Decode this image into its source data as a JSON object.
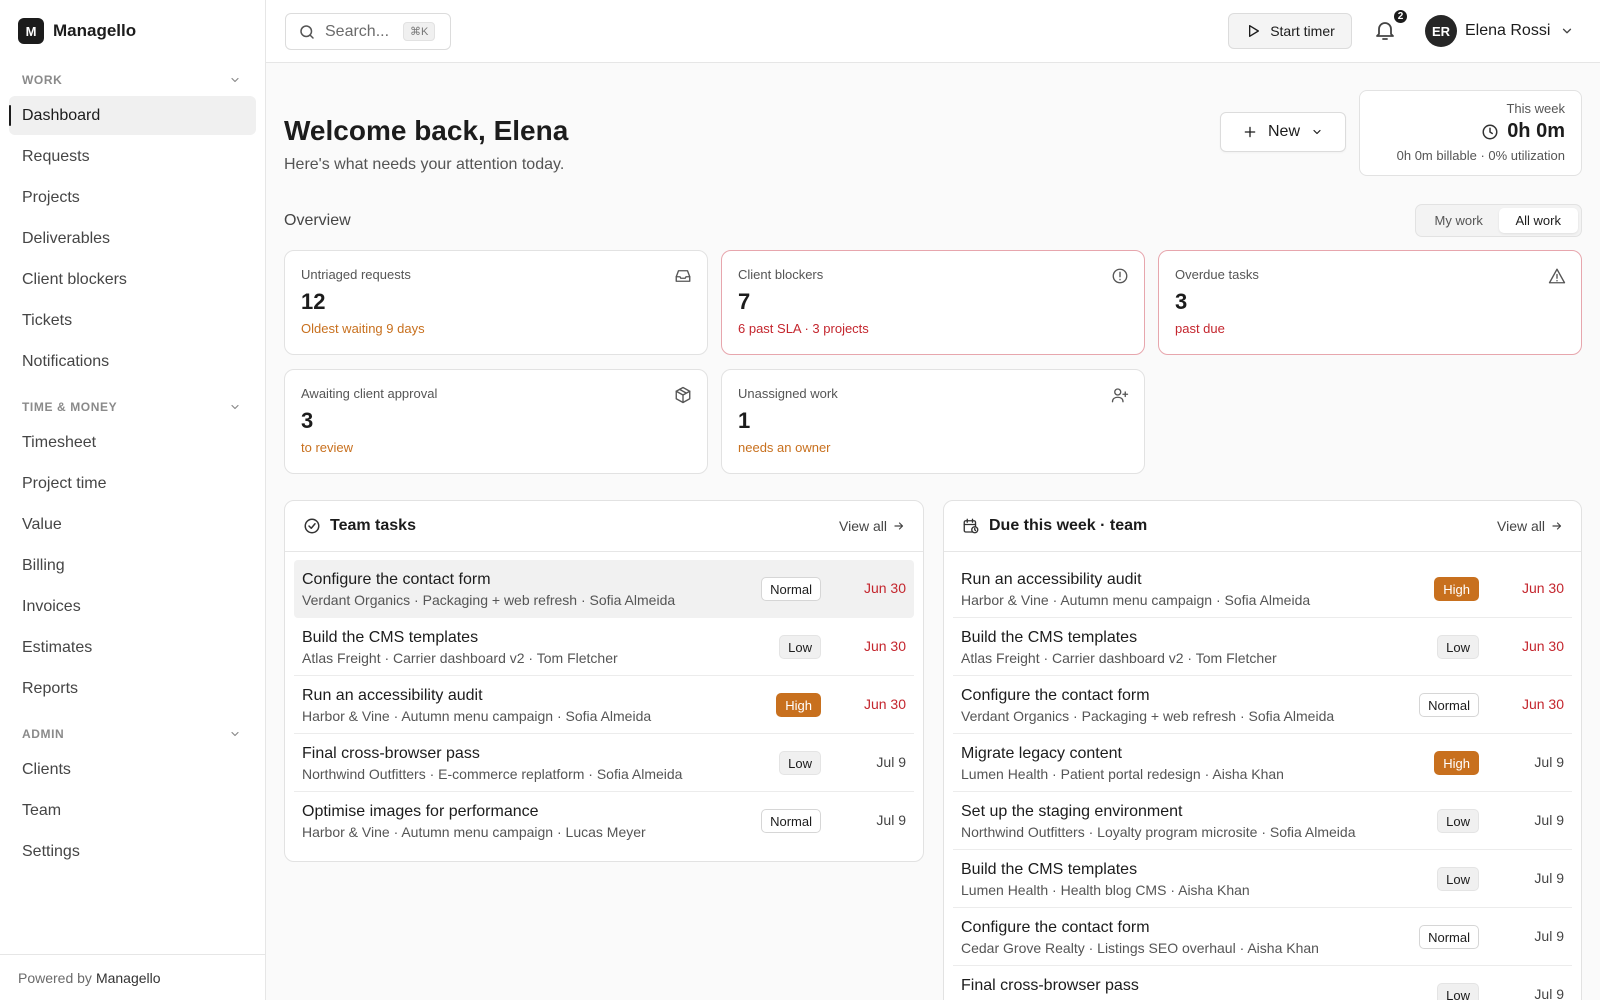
{
  "brand": {
    "logo_letter": "M",
    "name": "Managello"
  },
  "sidebar": {
    "sections": [
      {
        "title": "WORK",
        "items": [
          {
            "label": "Dashboard",
            "active": true
          },
          {
            "label": "Requests"
          },
          {
            "label": "Projects"
          },
          {
            "label": "Deliverables"
          },
          {
            "label": "Client blockers"
          },
          {
            "label": "Tickets"
          },
          {
            "label": "Notifications"
          }
        ]
      },
      {
        "title": "TIME & MONEY",
        "items": [
          {
            "label": "Timesheet"
          },
          {
            "label": "Project time"
          },
          {
            "label": "Value"
          },
          {
            "label": "Billing"
          },
          {
            "label": "Invoices"
          },
          {
            "label": "Estimates"
          },
          {
            "label": "Reports"
          }
        ]
      },
      {
        "title": "ADMIN",
        "items": [
          {
            "label": "Clients"
          },
          {
            "label": "Team"
          },
          {
            "label": "Settings"
          }
        ]
      }
    ],
    "footer": {
      "prefix": "Powered by",
      "brand": "Managello"
    }
  },
  "topbar": {
    "search_placeholder": "Search...",
    "search_shortcut": "⌘K",
    "timer_label": "Start timer",
    "notification_count": "2",
    "user": {
      "initials": "ER",
      "name": "Elena Rossi"
    }
  },
  "header": {
    "title": "Welcome back, Elena",
    "subtitle": "Here's what needs your attention today.",
    "new_label": "New"
  },
  "week": {
    "label": "This week",
    "total": "0h 0m",
    "footnote": "0h 0m billable · 0% utilization"
  },
  "overview": {
    "label": "Overview",
    "toggle": [
      "My work",
      "All work"
    ],
    "toggle_selected": "All work",
    "cards": [
      {
        "label": "Untriaged requests",
        "value": "12",
        "note": "Oldest waiting 9 days",
        "tone": "orange",
        "icon": "inbox-icon"
      },
      {
        "label": "Client blockers",
        "value": "7",
        "note": "6 past SLA · 3 projects",
        "tone": "red",
        "icon": "alert-circle-icon",
        "alert": true
      },
      {
        "label": "Overdue tasks",
        "value": "3",
        "note": "past due",
        "tone": "red",
        "icon": "warning-triangle-icon",
        "alert": true
      },
      {
        "label": "Awaiting client approval",
        "value": "3",
        "note": "to review",
        "tone": "orange",
        "icon": "package-icon"
      },
      {
        "label": "Unassigned work",
        "value": "1",
        "note": "needs an owner",
        "tone": "orange",
        "icon": "user-plus-icon"
      }
    ]
  },
  "team_tasks": {
    "title": "Team tasks",
    "view_all": "View all",
    "rows": [
      {
        "title": "Configure the contact form",
        "meta": "Verdant Organics · Packaging + web refresh · Sofia Almeida",
        "priority": "Normal",
        "date": "Jun 30",
        "overdue": true
      },
      {
        "title": "Build the CMS templates",
        "meta": "Atlas Freight · Carrier dashboard v2 · Tom Fletcher",
        "priority": "Low",
        "date": "Jun 30",
        "overdue": true
      },
      {
        "title": "Run an accessibility audit",
        "meta": "Harbor & Vine · Autumn menu campaign · Sofia Almeida",
        "priority": "High",
        "date": "Jun 30",
        "overdue": true
      },
      {
        "title": "Final cross-browser pass",
        "meta": "Northwind Outfitters · E-commerce replatform · Sofia Almeida",
        "priority": "Low",
        "date": "Jul 9",
        "overdue": false
      },
      {
        "title": "Optimise images for performance",
        "meta": "Harbor & Vine · Autumn menu campaign · Lucas Meyer",
        "priority": "Normal",
        "date": "Jul 9",
        "overdue": false
      }
    ]
  },
  "due_week": {
    "title": "Due this week · team",
    "view_all": "View all",
    "rows": [
      {
        "title": "Run an accessibility audit",
        "meta": "Harbor & Vine · Autumn menu campaign · Sofia Almeida",
        "priority": "High",
        "date": "Jun 30",
        "overdue": true
      },
      {
        "title": "Build the CMS templates",
        "meta": "Atlas Freight · Carrier dashboard v2 · Tom Fletcher",
        "priority": "Low",
        "date": "Jun 30",
        "overdue": true
      },
      {
        "title": "Configure the contact form",
        "meta": "Verdant Organics · Packaging + web refresh · Sofia Almeida",
        "priority": "Normal",
        "date": "Jun 30",
        "overdue": true
      },
      {
        "title": "Migrate legacy content",
        "meta": "Lumen Health · Patient portal redesign · Aisha Khan",
        "priority": "High",
        "date": "Jul 9",
        "overdue": false
      },
      {
        "title": "Set up the staging environment",
        "meta": "Northwind Outfitters · Loyalty program microsite · Sofia Almeida",
        "priority": "Low",
        "date": "Jul 9",
        "overdue": false
      },
      {
        "title": "Build the CMS templates",
        "meta": "Lumen Health · Health blog CMS · Aisha Khan",
        "priority": "Low",
        "date": "Jul 9",
        "overdue": false
      },
      {
        "title": "Configure the contact form",
        "meta": "Cedar Grove Realty · Listings SEO overhaul · Aisha Khan",
        "priority": "Normal",
        "date": "Jul 9",
        "overdue": false
      },
      {
        "title": "Final cross-browser pass",
        "meta": "",
        "priority": "Low",
        "date": "Jul 9",
        "overdue": false
      }
    ]
  },
  "colors": {
    "accent_orange": "#c8701e",
    "alert_red": "#c4262e",
    "alert_border": "#e7a6ad",
    "ink": "#1c1c1c"
  }
}
